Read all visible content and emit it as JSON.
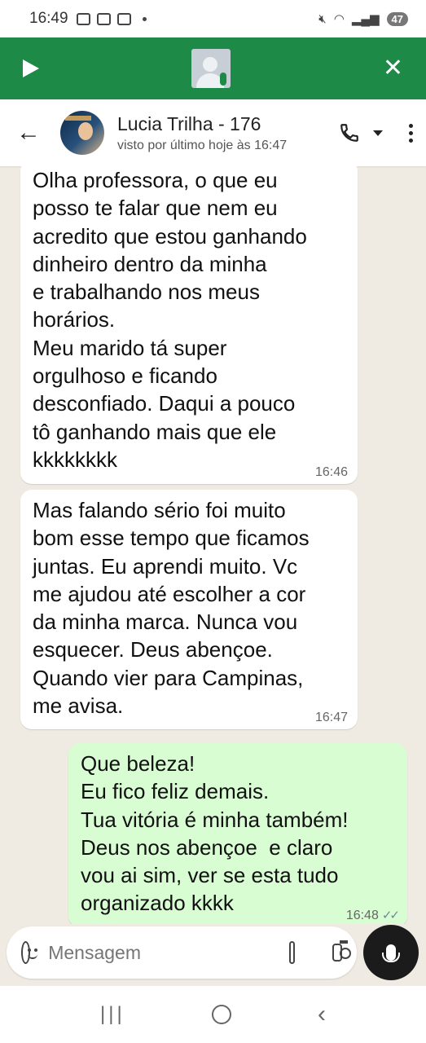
{
  "status_bar": {
    "time": "16:49",
    "battery": "47"
  },
  "call_banner": {},
  "header": {
    "contact_name": "Lucia Trilha - 176",
    "last_seen": "visto por último hoje às 16:47"
  },
  "messages": [
    {
      "direction": "incoming",
      "text": "Olha professora, o que eu\nposso te falar que nem eu\nacredito que estou ganhando\ndinheiro dentro da minha\ne trabalhando nos meus\nhorários.\nMeu marido tá super\norgulhoso e ficando\ndesconfiado. Daqui a pouco\ntô ganhando mais que ele\nkkkkkkkk",
      "time": "16:46"
    },
    {
      "direction": "incoming",
      "text": "Mas falando sério foi muito\nbom esse tempo que ficamos\njuntas. Eu aprendi muito. Vc\nme ajudou até escolher a cor\nda minha marca. Nunca vou\nesquecer. Deus abençoe.\nQuando vier para Campinas,\nme avisa.",
      "time": "16:47"
    },
    {
      "direction": "outgoing",
      "text": "Que beleza!\nEu fico feliz demais.\nTua vitória é minha também!\nDeus nos abençoe  e claro\nvou ai sim, ver se esta tudo\norganizado kkkk",
      "time": "16:48",
      "status": "read"
    }
  ],
  "composer": {
    "placeholder": "Mensagem"
  },
  "colors": {
    "banner": "#1e8a48",
    "chat_bg": "#efeae2",
    "incoming": "#ffffff",
    "outgoing": "#d9fdd3"
  }
}
